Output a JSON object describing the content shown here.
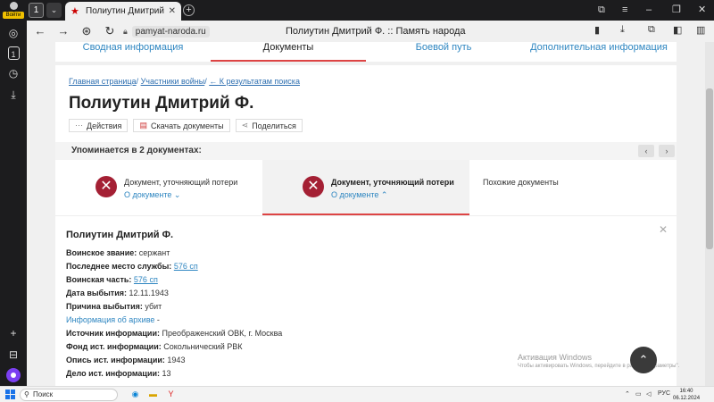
{
  "browser": {
    "login_label": "Войти",
    "tab_count": "1",
    "tab_title": "Полиутин Дмитрий Ф.",
    "url": "pamyat-naroda.ru",
    "page_title": "Полиутин Дмитрий Ф. :: Память народа"
  },
  "top_tabs": [
    {
      "label": "Сводная информация"
    },
    {
      "label": "Документы"
    },
    {
      "label": "Боевой путь"
    },
    {
      "label": "Дополнительная информация"
    }
  ],
  "breadcrumbs": {
    "home": "Главная страница",
    "participants": "Участники войны",
    "back": "← К результатам поиска"
  },
  "person_name": "Полиутин Дмитрий Ф.",
  "actions": {
    "actions_label": "Действия",
    "download_label": "Скачать документы",
    "share_label": "Поделиться"
  },
  "mention": {
    "text": "Упоминается в 2 документах:",
    "prev": "‹",
    "next": "›"
  },
  "documents": [
    {
      "title": "Документ, уточняющий потери",
      "link": "О документе ⌄"
    },
    {
      "title": "Документ, уточняющий потери",
      "link": "О документе ⌃"
    },
    {
      "title": "Похожие документы"
    }
  ],
  "details": {
    "name": "Полиутин Дмитрий Ф.",
    "rank_label": "Воинское звание:",
    "rank_value": "сержант",
    "last_service_label": "Последнее место службы:",
    "last_service_value": "576 сп",
    "unit_label": "Воинская часть:",
    "unit_value": "576 сп",
    "departure_date_label": "Дата выбытия:",
    "departure_date_value": "12.11.1943",
    "departure_reason_label": "Причина выбытия:",
    "departure_reason_value": "убит",
    "archive_info_label": "Информация об архиве",
    "archive_info_value": "-",
    "source_label": "Источник информации:",
    "source_value": "Преображенский ОВК, г. Москва",
    "fund_label": "Фонд ист. информации:",
    "fund_value": "Сокольнический РВК",
    "inventory_label": "Опись ист. информации:",
    "inventory_value": "1943",
    "case_label": "Дело ист. информации:",
    "case_value": "13"
  },
  "watermark": {
    "title": "Активация Windows",
    "subtitle": "Чтобы активировать Windows, перейдите в раздел \"Параметры\"."
  },
  "taskbar": {
    "search_placeholder": "Поиск",
    "lang": "РУС",
    "time": "16:40",
    "date": "06.12.2024"
  },
  "colors": {
    "accent_red": "#d44444",
    "link_blue": "#2e86c1",
    "icon_red": "#a42034"
  }
}
